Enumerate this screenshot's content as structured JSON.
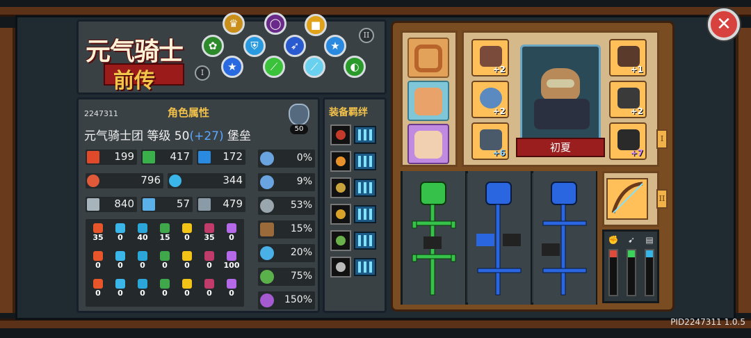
{
  "logo": {
    "line1": "元气骑士",
    "line2": "前传"
  },
  "skill_tier_labels": {
    "tier1": "I",
    "tier2": "II"
  },
  "attributes": {
    "id": "2247311",
    "title": "角色属性",
    "level_badge": "50",
    "info_prefix": "元气骑士团 等级 50",
    "info_bonus": "(+27)",
    "info_class": "堡垒",
    "stats": [
      {
        "icon": "fist-icon",
        "value": "199"
      },
      {
        "icon": "bolt-icon",
        "value": "417"
      },
      {
        "icon": "card-icon",
        "value": "172"
      },
      {
        "icon": "heart-icon",
        "value": "796"
      },
      {
        "icon": "drop-icon",
        "value": "344"
      },
      {
        "icon": "sword-icon",
        "value": "840"
      },
      {
        "icon": "staff-icon",
        "value": "57"
      },
      {
        "icon": "shield-icon",
        "value": "479"
      }
    ],
    "percent_stats": [
      {
        "icon": "arrow-up-icon",
        "value": "0%"
      },
      {
        "icon": "arrow-up-icon",
        "value": "9%"
      },
      {
        "icon": "crossed-swords-icon",
        "value": "53%"
      },
      {
        "icon": "boot-icon",
        "value": "15%"
      },
      {
        "icon": "clock-icon",
        "value": "20%"
      },
      {
        "icon": "crit-icon",
        "value": "75%"
      },
      {
        "icon": "crit-damage-icon",
        "value": "150%"
      }
    ],
    "element_rows": [
      [
        "35",
        "0",
        "40",
        "15",
        "0",
        "35",
        "0"
      ],
      [
        "0",
        "0",
        "0",
        "0",
        "0",
        "0",
        "100"
      ],
      [
        "0",
        "0",
        "0",
        "0",
        "0",
        "0",
        "0"
      ]
    ],
    "element_colors": [
      "#e8552a",
      "#3bb6e8",
      "#2aa6d8",
      "#3fa84a",
      "#f2c418",
      "#c03a6a",
      "#b46ae8"
    ]
  },
  "bond": {
    "title": "装备羁绊",
    "rows": [
      {
        "icon": "fire-ring-icon",
        "color": "#c43a2a"
      },
      {
        "icon": "flame-bomb-icon",
        "color": "#e8902a"
      },
      {
        "icon": "bullet-icon",
        "color": "#c8a23a"
      },
      {
        "icon": "heat-icon",
        "color": "#d8a22a"
      },
      {
        "icon": "scroll-icon",
        "color": "#6ab04a"
      },
      {
        "icon": "gear-icon",
        "color": "#bbbbbb"
      }
    ]
  },
  "equipment": {
    "hero_name": "初夏",
    "left_slots": [
      {
        "icon": "boxing-glove-icon",
        "level": "+2"
      },
      {
        "icon": "ring-icon",
        "level": "+2"
      },
      {
        "icon": "armor-icon",
        "level": "+6"
      }
    ],
    "right_slots": [
      {
        "icon": "beast-helmet-icon",
        "level": "+1"
      },
      {
        "icon": "chest-armor-icon",
        "level": "+2"
      },
      {
        "icon": "gauntlet-icon",
        "level": "+7"
      }
    ],
    "tab_labels": {
      "gear": "I",
      "weapon": "II"
    }
  },
  "talent_columns": [
    {
      "icon": "crossbow-icon",
      "color": "#36c24a"
    },
    {
      "icon": "tower-icon",
      "color": "#2a66e0"
    },
    {
      "icon": "shield-icon",
      "color": "#2a66e0"
    }
  ],
  "bars": [
    {
      "icon": "fist-icon",
      "color": "#e04a3a"
    },
    {
      "icon": "wing-icon",
      "color": "#3ad25a"
    },
    {
      "icon": "doc-icon",
      "color": "#36b6e8"
    }
  ],
  "footer": {
    "pid": "PID2247311 1.0.5"
  }
}
